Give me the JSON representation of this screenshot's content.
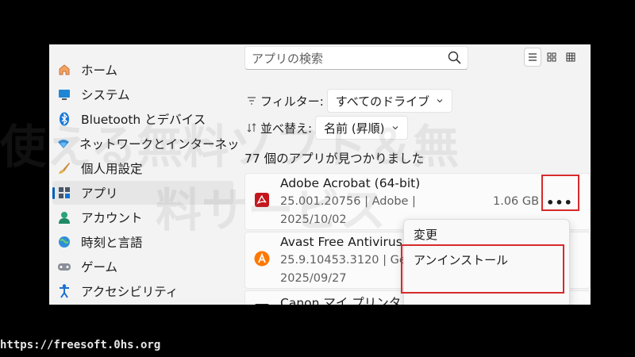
{
  "sidebar": {
    "items": [
      {
        "label": "ホーム",
        "icon": "home-icon"
      },
      {
        "label": "システム",
        "icon": "monitor-icon"
      },
      {
        "label": "Bluetooth とデバイス",
        "icon": "bluetooth-icon"
      },
      {
        "label": "ネットワークとインターネッ",
        "icon": "wifi-icon"
      },
      {
        "label": "個人用設定",
        "icon": "brush-icon"
      },
      {
        "label": "アプリ",
        "icon": "apps-icon",
        "active": true
      },
      {
        "label": "アカウント",
        "icon": "person-icon"
      },
      {
        "label": "時刻と言語",
        "icon": "globe-icon"
      },
      {
        "label": "ゲーム",
        "icon": "gamepad-icon"
      },
      {
        "label": "アクセシビリティ",
        "icon": "accessibility-icon"
      }
    ]
  },
  "search": {
    "placeholder": "アプリの検索"
  },
  "filter": {
    "label": "フィルター:",
    "value": "すべてのドライブ"
  },
  "sort": {
    "label": "並べ替え:",
    "value": "名前 (昇順)"
  },
  "count_text": "77 個のアプリが見つかりました",
  "apps": [
    {
      "name": "Adobe Acrobat (64-bit)",
      "meta1": "25.001.20756 | Adobe |",
      "meta2": "2025/10/02",
      "size": "1.06 GB",
      "icon": "acrobat-icon"
    },
    {
      "name": "Avast Free Antivirus",
      "meta1": "25.9.10453.3120 | Ge",
      "meta2": "2025/09/27",
      "icon": "avast-icon"
    },
    {
      "name": "Canon マイ プリンタ",
      "icon": "canon-icon"
    }
  ],
  "more_label": "•••",
  "context_menu": {
    "modify": "変更",
    "uninstall": "アンインストール"
  },
  "watermark": {
    "line1": "使える無料ソフト＆無",
    "line2": "料サービス"
  },
  "footer_url": "https://freesoft.0hs.org",
  "colors": {
    "accent": "#005fb8",
    "highlight": "#d62b2b",
    "acrobat": "#c4161c",
    "avast": "#ff7800"
  }
}
